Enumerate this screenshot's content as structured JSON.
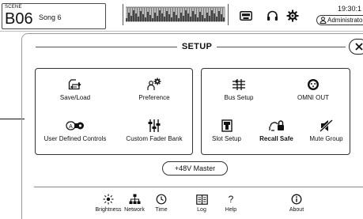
{
  "scene": {
    "caption": "SCENE",
    "number": "B06",
    "name": "Song 6"
  },
  "status": {
    "time": "19:30:1",
    "user": "Administrator"
  },
  "icons": {
    "monitor": "cassette-icon",
    "headphones": "headphones-icon",
    "settings": "gear-icon",
    "user": "user-icon"
  },
  "setup": {
    "title": "SETUP",
    "close_icon": "close-icon",
    "left_group": [
      {
        "id": "save-load",
        "label": "Save/Load",
        "icon": "save-load-icon"
      },
      {
        "id": "preference",
        "label": "Preference",
        "icon": "preference-icon"
      },
      {
        "id": "user-defined-controls",
        "label": "User Defined Controls",
        "icon": "user-defined-controls-icon"
      },
      {
        "id": "custom-fader-bank",
        "label": "Custom Fader Bank",
        "icon": "fader-bank-icon"
      }
    ],
    "right_group": [
      {
        "id": "bus-setup",
        "label": "Bus Setup",
        "icon": "bus-setup-icon"
      },
      {
        "id": "omni-out",
        "label": "OMNI OUT",
        "icon": "omni-out-icon"
      },
      {
        "id": "slot-setup",
        "label": "Slot Setup",
        "icon": "slot-setup-icon"
      },
      {
        "id": "recall-safe",
        "label": "Recall Safe",
        "icon": "recall-safe-icon",
        "bold": true
      },
      {
        "id": "mute-group",
        "label": "Mute Group",
        "icon": "mute-group-icon"
      }
    ],
    "phantom_button": "+48V Master",
    "bottom_bar": [
      {
        "id": "brightness",
        "label": "Brightness",
        "icon": "brightness-icon"
      },
      {
        "id": "network",
        "label": "Network",
        "icon": "network-icon"
      },
      {
        "id": "time",
        "label": "Time",
        "icon": "clock-icon"
      },
      {
        "id": "log",
        "label": "Log",
        "icon": "log-icon"
      },
      {
        "id": "help",
        "label": "Help",
        "icon": "help-icon"
      },
      {
        "id": "about",
        "label": "About",
        "icon": "info-icon"
      }
    ]
  }
}
